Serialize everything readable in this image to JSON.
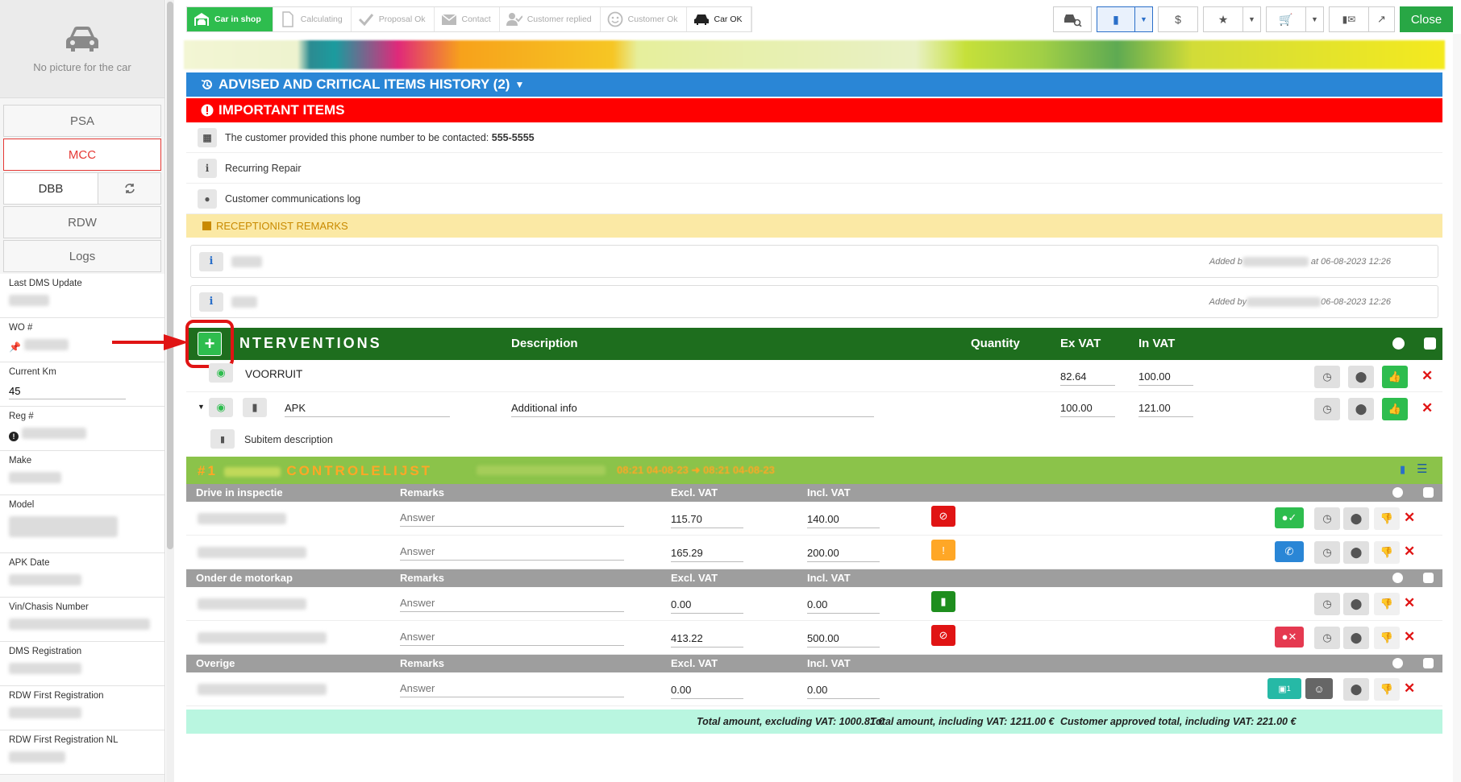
{
  "sidebar": {
    "no_picture": "No picture for the car",
    "buttons": {
      "psa": "PSA",
      "mcc": "MCC",
      "dbb": "DBB",
      "rdw": "RDW",
      "logs": "Logs"
    },
    "fields": {
      "last_dms_update": "Last DMS Update",
      "wo": "WO #",
      "current_km": "Current Km",
      "current_km_value": "45",
      "reg": "Reg #",
      "make": "Make",
      "model": "Model",
      "apk_date": "APK Date",
      "vin": "Vin/Chasis Number",
      "dms_registration": "DMS Registration",
      "rdw_first_registration": "RDW First Registration",
      "rdw_first_registration_nl": "RDW First Registration NL"
    }
  },
  "steps": [
    {
      "label": "Car in shop",
      "icon": "car-in-shop-icon",
      "state": "active"
    },
    {
      "label": "Calculating",
      "icon": "document-icon",
      "state": "pending"
    },
    {
      "label": "Proposal Ok",
      "icon": "check-icon",
      "state": "pending"
    },
    {
      "label": "Contact",
      "icon": "envelope-icon",
      "state": "pending"
    },
    {
      "label": "Customer replied",
      "icon": "user-check-icon",
      "state": "pending"
    },
    {
      "label": "Customer Ok",
      "icon": "smiley-icon",
      "state": "pending"
    },
    {
      "label": "Car OK",
      "icon": "car-icon",
      "state": "done"
    }
  ],
  "toolbar": {
    "dollar": "$",
    "close": "Close"
  },
  "history_bar": "ADVISED AND CRITICAL ITEMS HISTORY (2)",
  "important_bar": "IMPORTANT ITEMS",
  "important": {
    "phone_text": "The customer provided this phone number to be contacted:",
    "phone_number": "555-5555",
    "recurring": "Recurring Repair",
    "comm_log": "Customer communications log",
    "info_glyph": "i"
  },
  "remarks": {
    "header": "RECEPTIONIST REMARKS",
    "items": [
      {
        "added_prefix": "Added b",
        "added_suffix": "at 06-08-2023 12:26"
      },
      {
        "added_prefix": "Added by",
        "added_suffix": "06-08-2023 12:26"
      }
    ]
  },
  "interventions": {
    "title": "NTERVENTIONS",
    "columns": {
      "description": "Description",
      "quantity": "Quantity",
      "ex_vat": "Ex VAT",
      "in_vat": "In VAT"
    },
    "rows": [
      {
        "name": "VOORRUIT",
        "ex_vat": "82.64",
        "in_vat": "100.00"
      },
      {
        "name": "APK",
        "description": "Additional info",
        "ex_vat": "100.00",
        "in_vat": "121.00"
      }
    ],
    "subitem": "Subitem description"
  },
  "checklist": {
    "title": "#1",
    "title_rest": "CONTROLELIJST",
    "time": "08:21 04-08-23 ➜ 08:21 04-08-23",
    "groups": [
      {
        "name": "Drive in inspectie",
        "rows": [
          {
            "excl": "115.70",
            "incl": "140.00",
            "status": "red"
          },
          {
            "excl": "165.29",
            "incl": "200.00",
            "status": "orange"
          }
        ]
      },
      {
        "name": "Onder de motorkap",
        "rows": [
          {
            "excl": "0.00",
            "incl": "0.00",
            "status": "green"
          },
          {
            "excl": "413.22",
            "incl": "500.00",
            "status": "red"
          }
        ]
      },
      {
        "name": "Overige",
        "rows": [
          {
            "excl": "0.00",
            "incl": "0.00",
            "status": ""
          }
        ]
      }
    ],
    "col_remarks": "Remarks",
    "col_excl": "Excl. VAT",
    "col_incl": "Incl. VAT",
    "answer_placeholder": "Answer",
    "photo_count": "1"
  },
  "totals": {
    "excl": "Total amount, excluding VAT: 1000.81 €",
    "incl": "Total amount, including VAT: 1211.00 €",
    "approved": "Customer approved total, including VAT: 221.00 €"
  }
}
